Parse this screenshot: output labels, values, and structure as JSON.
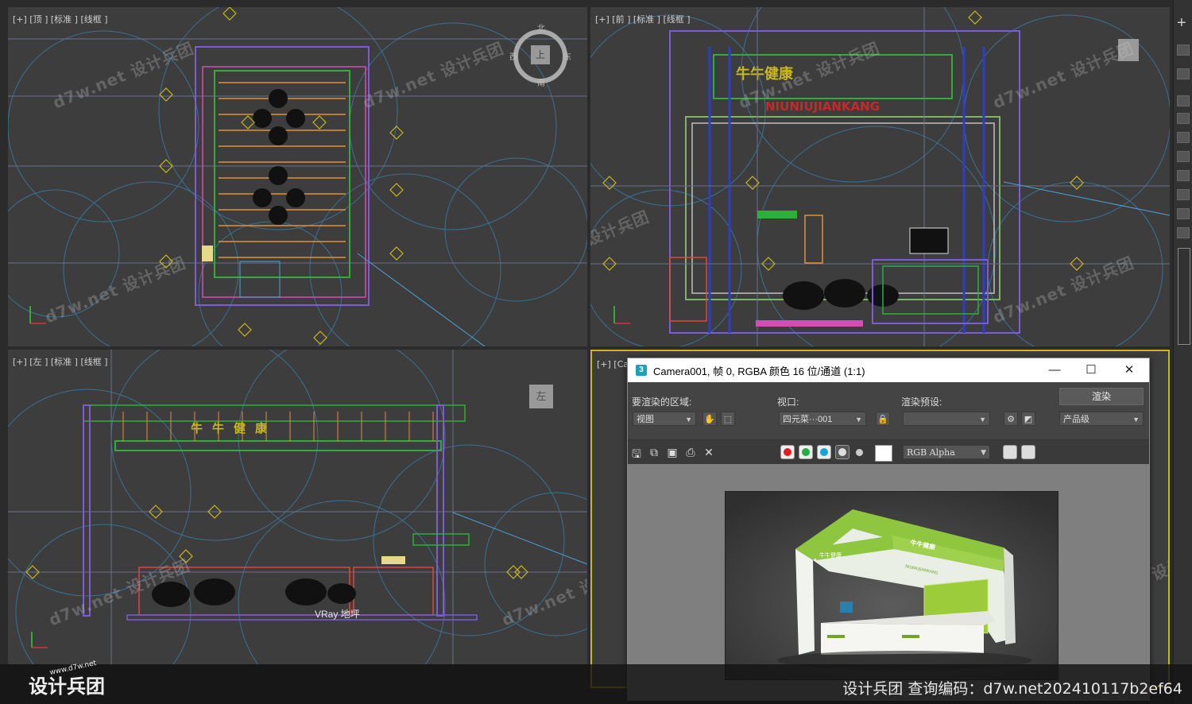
{
  "viewports": {
    "top": {
      "label": "[+] [顶 ] [标准 ] [线框 ]"
    },
    "front": {
      "label": "[+] [前 ] [标准 ] [线框 ]"
    },
    "left": {
      "label": "[+] [左 ] [标准 ] [线框 ]"
    },
    "camera": {
      "label": "[+] [Ca"
    }
  },
  "viewcube": {
    "top_face": "上",
    "north": "北",
    "south": "南",
    "east": "东",
    "west": "西",
    "left_face": "左"
  },
  "booth_sign": "牛牛健康",
  "booth_sign_latin": "NIUNIUJIANKANG",
  "vray_label": "VRay 地坪",
  "watermark": {
    "text": "d7w.net 设计兵团"
  },
  "render_frame": {
    "title": "Camera001, 帧 0, RGBA 颜色 16 位/通道 (1:1)",
    "icon": "3",
    "area_label": "要渲染的区域:",
    "area_value": "视图",
    "viewport_label": "视口:",
    "viewport_value": "四元菜···001",
    "preset_label": "渲染预设:",
    "preset_value": "",
    "render_button": "渲染",
    "quality_value": "产品级",
    "channel_value": "RGB Alpha"
  },
  "footer": {
    "logo_text": "设计兵团",
    "logo_url": "www.d7w.net",
    "query": "设计兵团  查询编码：d7w.net202410117b2ef64"
  },
  "colors": {
    "accent_yellow": "#c9b81e",
    "booth_green": "#8bc34a",
    "viewport_bg": "#3d3d3d"
  }
}
